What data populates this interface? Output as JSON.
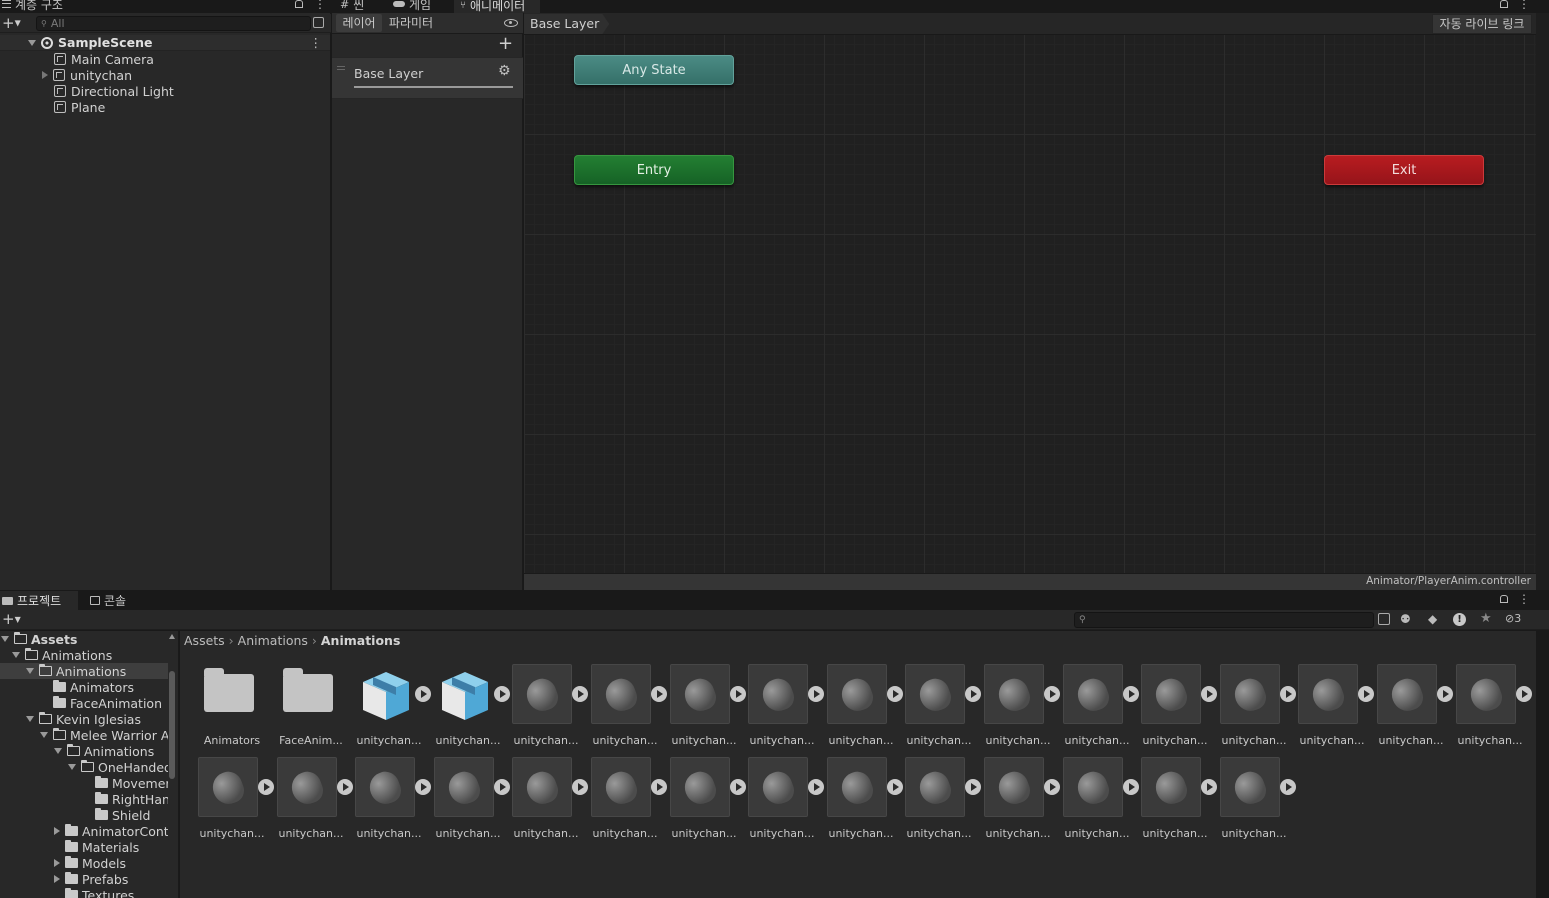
{
  "hierarchy": {
    "tab_label": "계층 구조",
    "search_placeholder": "All",
    "scene_name": "SampleScene",
    "items": [
      "Main Camera",
      "unitychan",
      "Directional Light",
      "Plane"
    ]
  },
  "top_tabs": [
    {
      "label": "씬"
    },
    {
      "label": "게임"
    },
    {
      "label": "애니메이터"
    }
  ],
  "animator": {
    "layers_tab": "레이어",
    "params_tab": "파라미터",
    "layer_name": "Base Layer",
    "breadcrumb": "Base Layer",
    "live_link": "자동 라이브 링크",
    "nodes": {
      "any_state": "Any State",
      "entry": "Entry",
      "exit": "Exit"
    },
    "footer_path": "Animator/PlayerAnim.controller",
    "colors": {
      "any_state": "#3b7a74",
      "entry": "#1c6b2a",
      "exit": "#a8151a"
    }
  },
  "project": {
    "tab_project": "프로젝트",
    "tab_console": "콘솔",
    "hidden_count": "3",
    "breadcrumb": [
      "Assets",
      "Animations",
      "Animations"
    ],
    "tree": [
      {
        "label": "Assets"
      },
      {
        "label": "Animations"
      },
      {
        "label": "Animations"
      },
      {
        "label": "Animators"
      },
      {
        "label": "FaceAnimation"
      },
      {
        "label": "Kevin Iglesias"
      },
      {
        "label": "Melee Warrior Ai"
      },
      {
        "label": "Animations"
      },
      {
        "label": "OneHanded"
      },
      {
        "label": "Movemer"
      },
      {
        "label": "RightHan"
      },
      {
        "label": "Shield"
      },
      {
        "label": "AnimatorCont"
      },
      {
        "label": "Materials"
      },
      {
        "label": "Models"
      },
      {
        "label": "Prefabs"
      },
      {
        "label": "Textures"
      }
    ],
    "assets": [
      {
        "label": "Animators",
        "kind": "folder-icon"
      },
      {
        "label": "FaceAnim...",
        "kind": "folder-icon"
      },
      {
        "label": "unitychan...",
        "kind": "package-icon"
      },
      {
        "label": "unitychan...",
        "kind": "package-icon"
      },
      {
        "label": "unitychan...",
        "kind": "anim"
      },
      {
        "label": "unitychan...",
        "kind": "anim"
      },
      {
        "label": "unitychan...",
        "kind": "anim"
      },
      {
        "label": "unitychan...",
        "kind": "anim"
      },
      {
        "label": "unitychan...",
        "kind": "anim"
      },
      {
        "label": "unitychan...",
        "kind": "anim"
      },
      {
        "label": "unitychan...",
        "kind": "anim"
      },
      {
        "label": "unitychan...",
        "kind": "anim"
      },
      {
        "label": "unitychan...",
        "kind": "anim"
      },
      {
        "label": "unitychan...",
        "kind": "anim"
      },
      {
        "label": "unitychan...",
        "kind": "anim"
      },
      {
        "label": "unitychan...",
        "kind": "anim"
      },
      {
        "label": "unitychan...",
        "kind": "anim"
      },
      {
        "label": "unitychan...",
        "kind": "anim"
      },
      {
        "label": "unitychan...",
        "kind": "anim"
      },
      {
        "label": "unitychan...",
        "kind": "anim"
      },
      {
        "label": "unitychan...",
        "kind": "anim"
      },
      {
        "label": "unitychan...",
        "kind": "anim"
      },
      {
        "label": "unitychan...",
        "kind": "anim"
      },
      {
        "label": "unitychan...",
        "kind": "anim"
      },
      {
        "label": "unitychan...",
        "kind": "anim"
      },
      {
        "label": "unitychan...",
        "kind": "anim"
      },
      {
        "label": "unitychan...",
        "kind": "anim"
      },
      {
        "label": "unitychan...",
        "kind": "anim"
      },
      {
        "label": "unitychan...",
        "kind": "anim"
      },
      {
        "label": "unitychan...",
        "kind": "anim"
      },
      {
        "label": "unitychan...",
        "kind": "anim"
      }
    ]
  }
}
